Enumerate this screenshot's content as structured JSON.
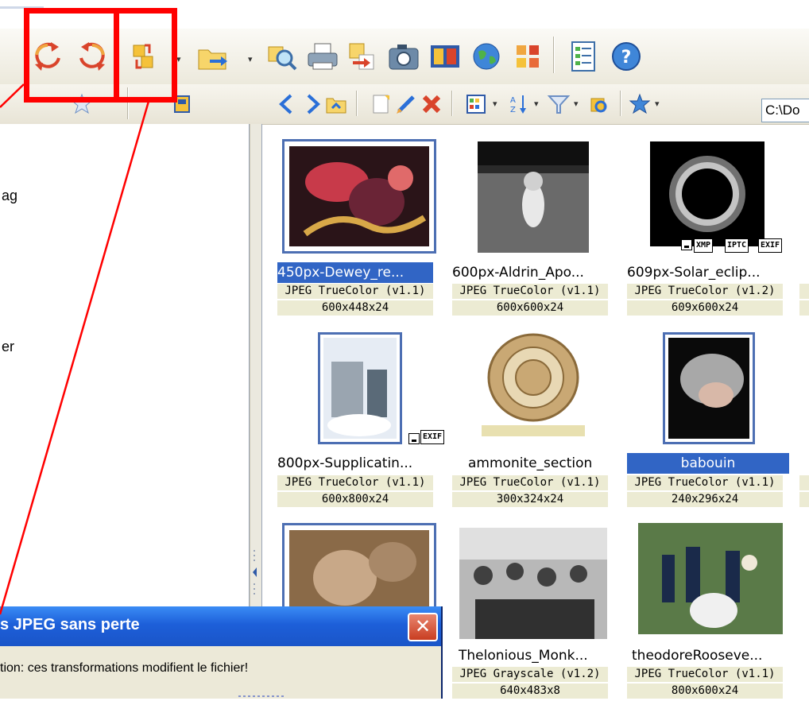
{
  "toolbar": {
    "rotate_left": "rotate-left-icon",
    "rotate_right": "rotate-right-icon",
    "lossless_transform": "lossless-transform-icon",
    "dropdown_arrow": "▾",
    "path_value": "C:\\Do"
  },
  "left_panel": {
    "partial_text_1": "ag",
    "partial_text_2": "er"
  },
  "thumbnails": [
    {
      "name": "450px-Dewey_re...",
      "format": "JPEG TrueColor (v1.1)",
      "dims": "600x448x24",
      "selected_name": true
    },
    {
      "name": "600px-Aldrin_Apo...",
      "format": "JPEG TrueColor (v1.1)",
      "dims": "600x600x24"
    },
    {
      "name": "609px-Solar_eclip...",
      "format": "JPEG TrueColor (v1.2)",
      "dims": "609x600x24",
      "badges": [
        "XMP",
        "IPTC",
        "EXIF"
      ]
    },
    {
      "name": "800px-Supplicatin...",
      "format": "JPEG TrueColor (v1.1)",
      "dims": "600x800x24",
      "badges": [
        "EXIF"
      ]
    },
    {
      "name": "ammonite_section",
      "format": "JPEG TrueColor (v1.1)",
      "dims": "300x324x24"
    },
    {
      "name": "babouin",
      "format": "JPEG TrueColor (v1.1)",
      "dims": "240x296x24",
      "selected_name": true
    },
    {
      "name": "Thelonious_Monk...",
      "format": "JPEG Grayscale (v1.2)",
      "dims": "640x483x8"
    },
    {
      "name": "theodoreRooseve...",
      "format": "JPEG TrueColor (v1.1)",
      "dims": "800x600x24"
    }
  ],
  "dialog": {
    "title": "s JPEG sans perte",
    "message": "tion: ces transformations modifient le fichier!",
    "close_label": "✕"
  },
  "colors": {
    "annotation": "#ff0000",
    "selection": "#3165c5",
    "info_bg": "#ecebd3"
  }
}
